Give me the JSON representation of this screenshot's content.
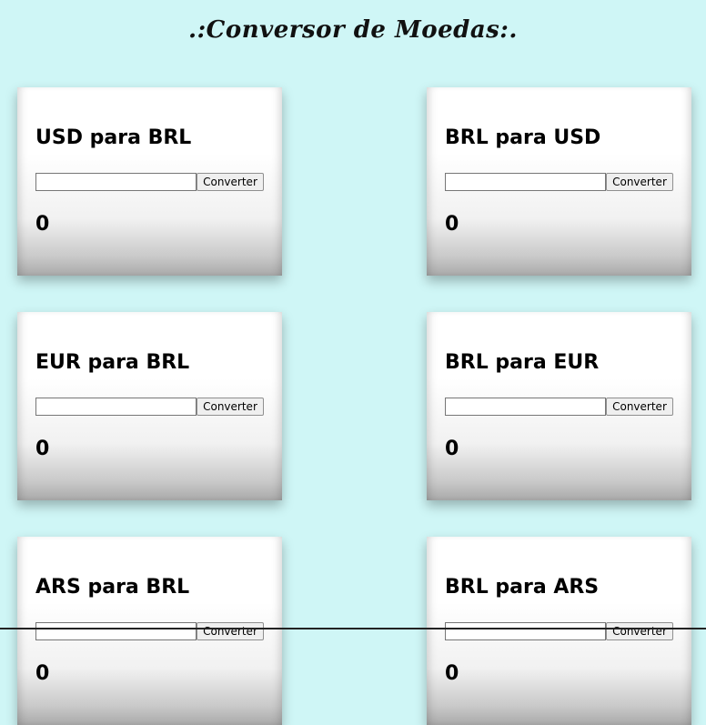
{
  "page": {
    "title": ".:Conversor de Moedas:.",
    "background_color": "#cff6f6"
  },
  "cards": [
    {
      "title": "USD para BRL",
      "input_value": "",
      "button_label": "Converter",
      "result": "0"
    },
    {
      "title": "BRL para USD",
      "input_value": "",
      "button_label": "Converter",
      "result": "0"
    },
    {
      "title": "EUR para BRL",
      "input_value": "",
      "button_label": "Converter",
      "result": "0"
    },
    {
      "title": "BRL para EUR",
      "input_value": "",
      "button_label": "Converter",
      "result": "0"
    },
    {
      "title": "ARS para BRL",
      "input_value": "",
      "button_label": "Converter",
      "result": "0"
    },
    {
      "title": "BRL para ARS",
      "input_value": "",
      "button_label": "Converter",
      "result": "0"
    }
  ]
}
